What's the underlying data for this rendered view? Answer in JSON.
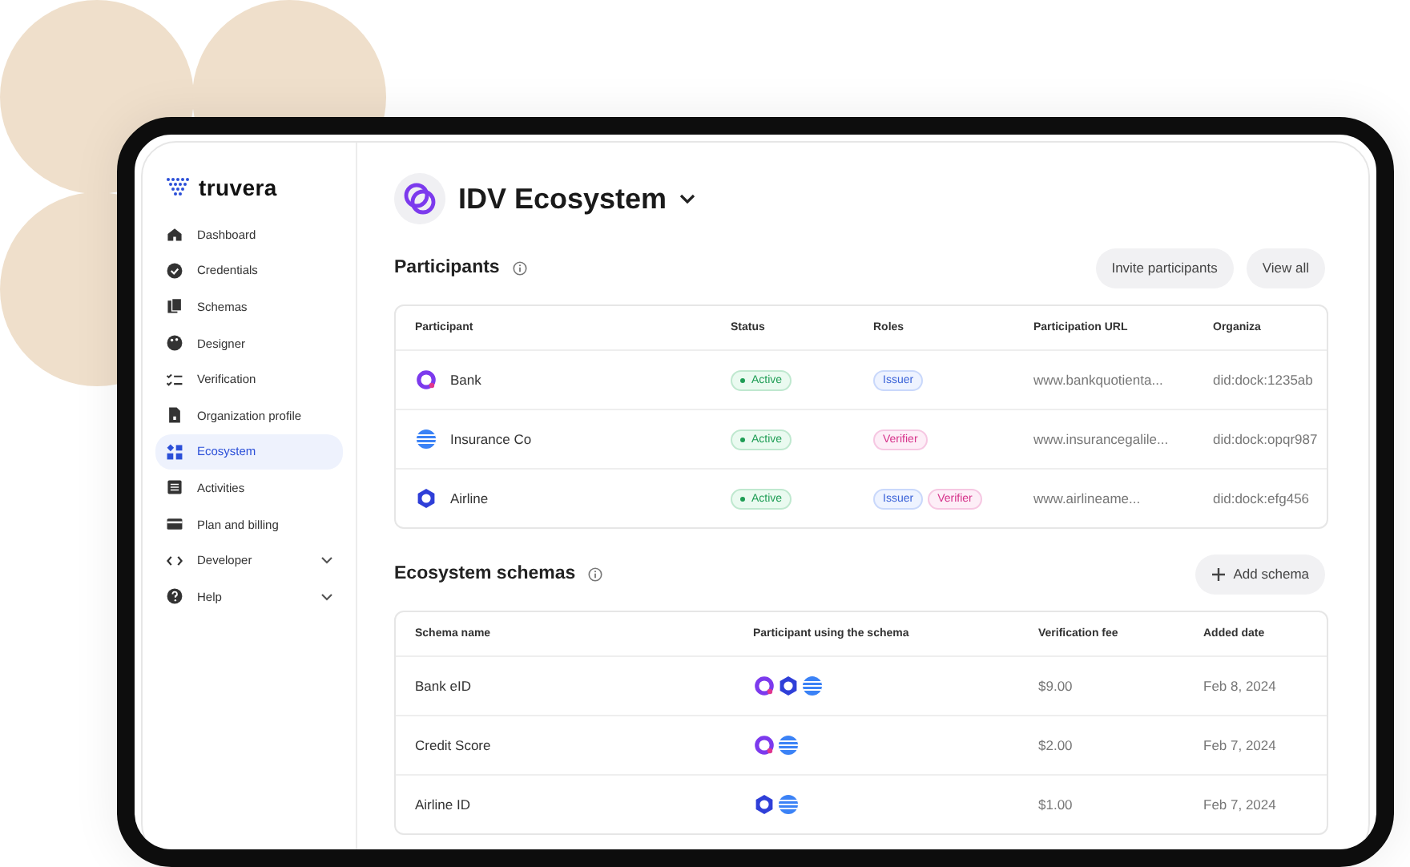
{
  "brand": "truvera",
  "sidebar": {
    "items": [
      {
        "label": "Dashboard",
        "selected": false
      },
      {
        "label": "Credentials",
        "selected": false
      },
      {
        "label": "Schemas",
        "selected": false
      },
      {
        "label": "Designer",
        "selected": false
      },
      {
        "label": "Verification",
        "selected": false
      },
      {
        "label": "Organization profile",
        "selected": false
      },
      {
        "label": "Ecosystem",
        "selected": true
      },
      {
        "label": "Activities",
        "selected": false
      },
      {
        "label": "Plan and billing",
        "selected": false
      },
      {
        "label": "Developer",
        "selected": false,
        "expanded": false
      },
      {
        "label": "Help",
        "selected": false,
        "expanded": false
      }
    ]
  },
  "header": {
    "title": "IDV Ecosystem"
  },
  "participants": {
    "title": "Participants",
    "buttons": [
      "Invite participants",
      "View all"
    ],
    "columns": [
      "Participant",
      "Status",
      "Roles",
      "Participation URL",
      "Organiza"
    ],
    "rows": [
      {
        "name": "Bank",
        "kind": "q",
        "status": "Active",
        "roles": [
          {
            "label": "Issuer",
            "kind": "issuer"
          }
        ],
        "url": "www.bankquotienta...",
        "org": "did:dock:1235ab"
      },
      {
        "name": "Insurance Co",
        "kind": "globe",
        "status": "Active",
        "roles": [
          {
            "label": "Verifier",
            "kind": "verifier"
          }
        ],
        "url": "www.insurancegalile...",
        "org": "did:dock:opqr987"
      },
      {
        "name": "Airline",
        "kind": "ring",
        "status": "Active",
        "roles": [
          {
            "label": "Issuer",
            "kind": "issuer"
          },
          {
            "label": "Verifier",
            "kind": "verifier"
          }
        ],
        "url": "www.airlineame...",
        "org": "did:dock:efg456"
      }
    ]
  },
  "schemas": {
    "title": "Ecosystem schemas",
    "button": "Add schema",
    "columns": [
      "Schema name",
      "Participant using the schema",
      "Verification fee",
      "Added date"
    ],
    "rows": [
      {
        "name": "Bank eID",
        "logos": [
          {
            "kind": "q"
          },
          {
            "kind": "ring"
          },
          {
            "kind": "globe"
          }
        ],
        "fee": "$9.00",
        "date": "Feb 8, 2024"
      },
      {
        "name": "Credit Score",
        "logos": [
          {
            "kind": "q"
          },
          {
            "kind": "globe"
          }
        ],
        "fee": "$2.00",
        "date": "Feb 7, 2024"
      },
      {
        "name": "Airline ID",
        "logos": [
          {
            "kind": "ring"
          },
          {
            "kind": "globe"
          }
        ],
        "fee": "$1.00",
        "date": "Feb 7, 2024"
      }
    ]
  }
}
